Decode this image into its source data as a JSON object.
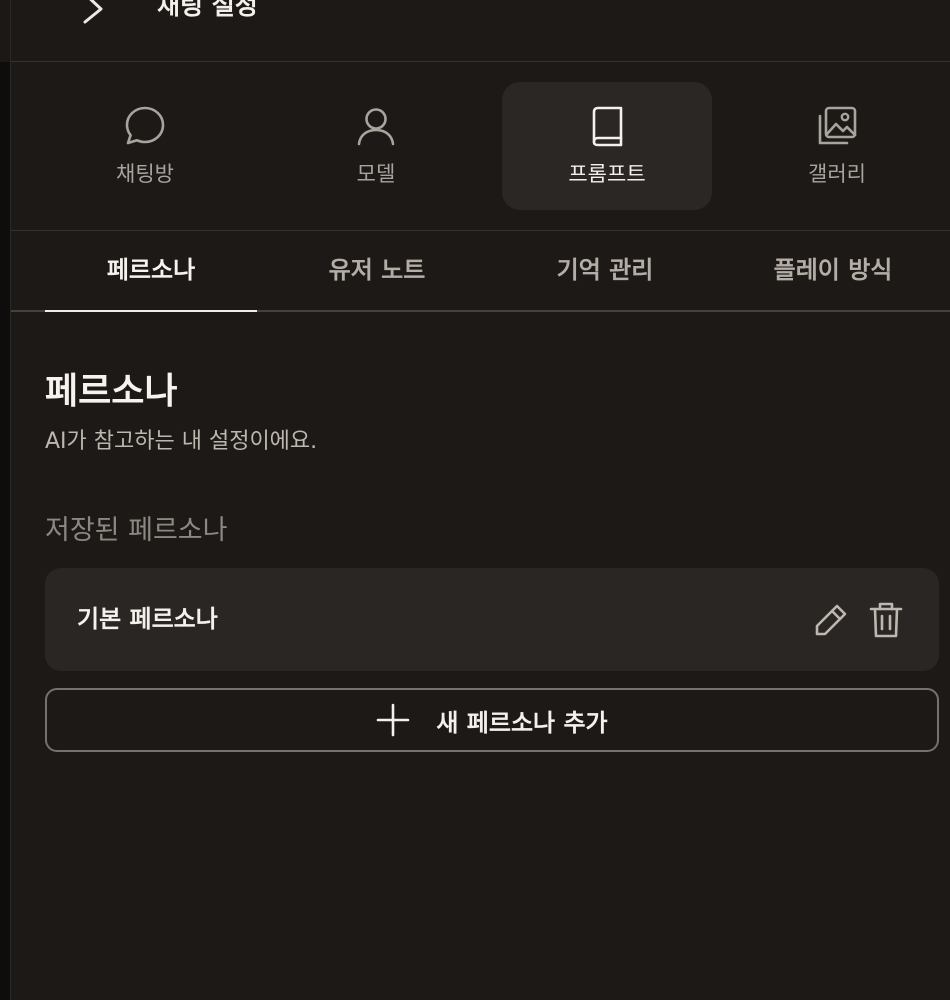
{
  "header": {
    "title": "채팅 설정",
    "back_icon": "chevron-right-icon"
  },
  "top_tabs": [
    {
      "label": "채팅방",
      "icon": "chat-bubble-icon",
      "active": false
    },
    {
      "label": "모델",
      "icon": "user-icon",
      "active": false
    },
    {
      "label": "프롬프트",
      "icon": "book-icon",
      "active": true
    },
    {
      "label": "갤러리",
      "icon": "gallery-icon",
      "active": false
    }
  ],
  "sub_tabs": [
    {
      "label": "페르소나",
      "active": true
    },
    {
      "label": "유저 노트",
      "active": false
    },
    {
      "label": "기억 관리",
      "active": false
    },
    {
      "label": "플레이 방식",
      "active": false
    }
  ],
  "section": {
    "title": "페르소나",
    "description": "AI가 참고하는 내 설정이에요."
  },
  "saved": {
    "label": "저장된 페르소나",
    "items": [
      {
        "name": "기본 페르소나",
        "edit_icon": "pencil-icon",
        "delete_icon": "trash-icon"
      }
    ]
  },
  "add_button": {
    "label": "새 페르소나 추가",
    "icon": "plus-icon"
  },
  "colors": {
    "background": "#1c1916",
    "card": "#2a2624",
    "active_tab": "#2b2725",
    "text_primary": "#f4f0eb",
    "text_muted": "#a9a39d"
  }
}
